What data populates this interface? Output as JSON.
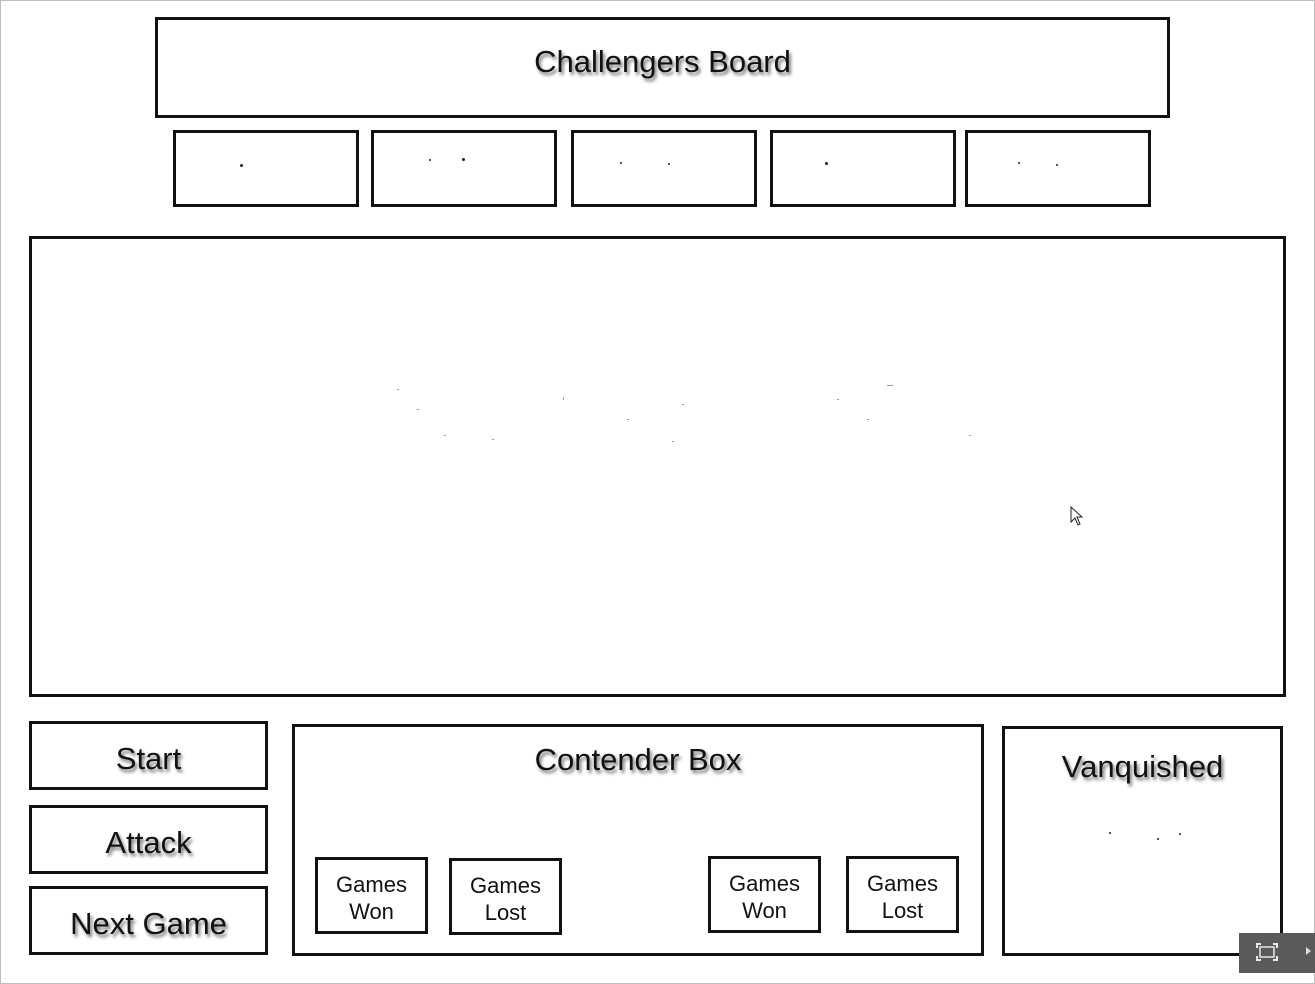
{
  "board": {
    "title": "Challengers Board"
  },
  "controls": {
    "start_label": "Start",
    "attack_label": "Attack",
    "next_game_label": "Next Game"
  },
  "contender": {
    "title": "Contender Box",
    "stats": [
      {
        "top": "Games",
        "bottom": "Won"
      },
      {
        "top": "Games",
        "bottom": "Lost"
      },
      {
        "top": "Games",
        "bottom": "Won"
      },
      {
        "top": "Games",
        "bottom": "Lost"
      }
    ]
  },
  "vanquished": {
    "title": "Vanquished"
  },
  "icons": {
    "fullscreen": "fullscreen-icon",
    "cursor": "mouse-cursor-icon"
  },
  "colors": {
    "border": "#111111",
    "background": "#ffffff",
    "control_overlay": "#5a5a5a"
  }
}
